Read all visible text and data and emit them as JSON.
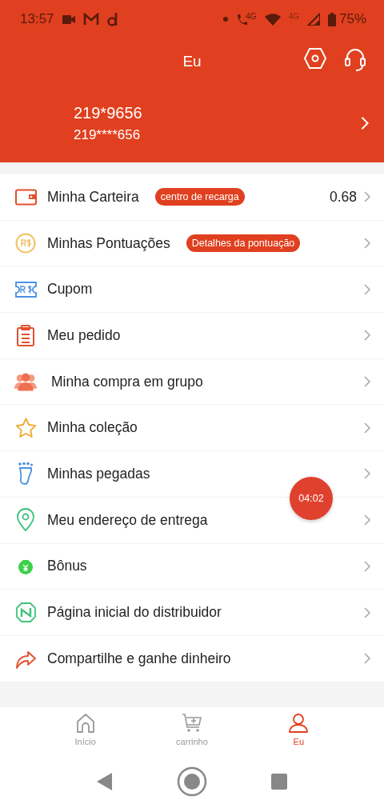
{
  "status_bar": {
    "time": "13:57",
    "call_network": "4G",
    "mobile_network": "4G",
    "battery": "75%"
  },
  "header": {
    "title": "Eu"
  },
  "profile": {
    "name": "219*9656",
    "phone": "219****656"
  },
  "menu": [
    {
      "kind": "wallet",
      "label": "Minha Carteira",
      "badge": "centro de recarga",
      "value": "0.68"
    },
    {
      "kind": "points",
      "label": "Minhas Pontuações",
      "badge": "Detalhes da pontuação"
    },
    {
      "kind": "coupon",
      "label": "Cupom"
    },
    {
      "kind": "order",
      "label": "Meu pedido"
    },
    {
      "kind": "group",
      "label": "Minha compra em grupo"
    },
    {
      "kind": "star",
      "label": "Minha coleção"
    },
    {
      "kind": "footprint",
      "label": "Minhas pegadas"
    },
    {
      "kind": "location",
      "label": "Meu endereço de entrega"
    },
    {
      "kind": "bonus",
      "label": "Bônus"
    },
    {
      "kind": "distributor",
      "label": "Página inicial do distribuidor"
    },
    {
      "kind": "share",
      "label": "Compartilhe e ganhe dinheiro"
    }
  ],
  "timer": "04:02",
  "tabs": [
    {
      "kind": "home",
      "label": "Início",
      "selected": false
    },
    {
      "kind": "cart",
      "label": "carrinho",
      "selected": false
    },
    {
      "kind": "user",
      "label": "Eu",
      "selected": true
    }
  ]
}
